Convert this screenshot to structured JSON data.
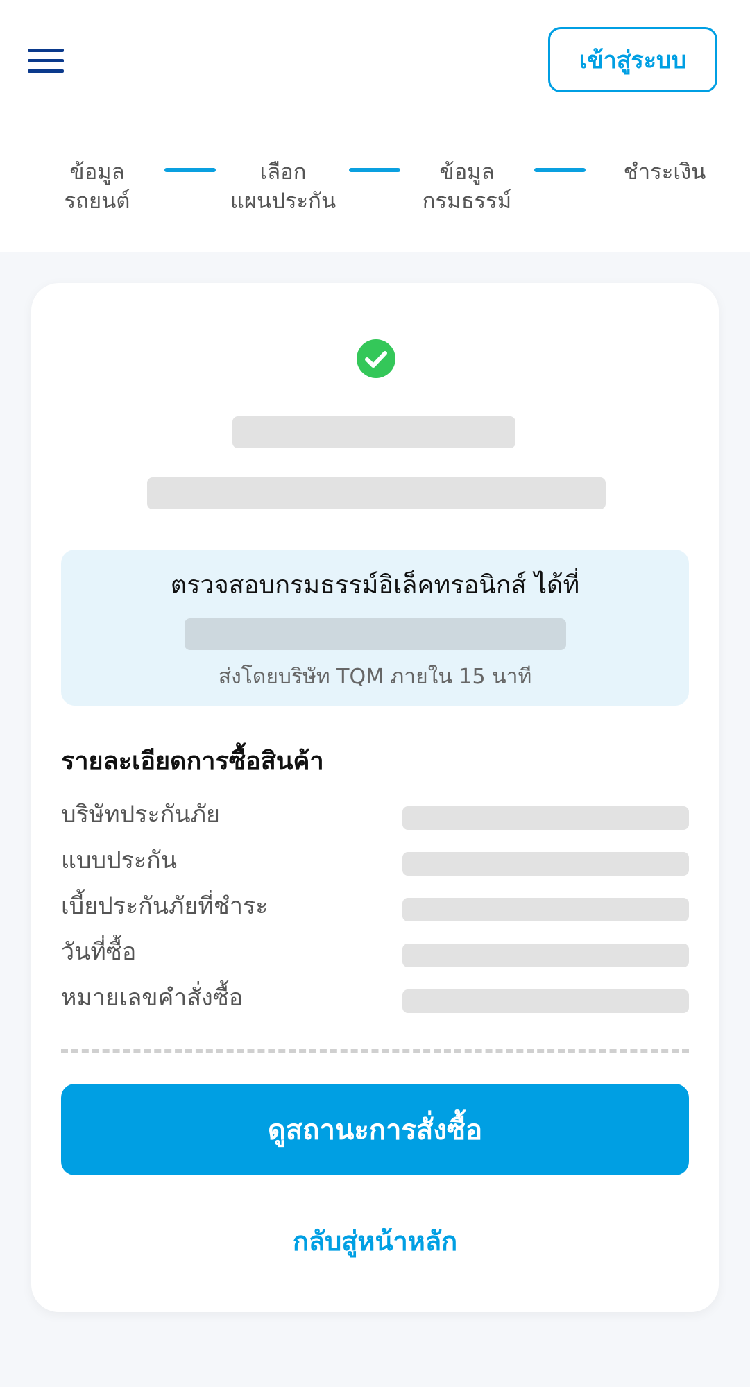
{
  "header": {
    "menu_icon": "hamburger-menu-icon",
    "login_label": "เข้าสู่ระบบ"
  },
  "stepper": {
    "steps": [
      {
        "label": "ข้อมูล\nรถยนต์"
      },
      {
        "label": "เลือก\nแผนประกัน"
      },
      {
        "label": "ข้อมูล\nกรมธรรม์"
      },
      {
        "label": "ชำระเงิน"
      }
    ]
  },
  "card": {
    "status_icon": "check-circle-icon",
    "info_box": {
      "title": "ตรวจสอบกรมธรรม์อิเล็คทรอนิกส์ ได้ที่",
      "note": "ส่งโดยบริษัท TQM ภายใน 15 นาที"
    },
    "details": {
      "title": "รายละเอียดการซื้อสินค้า",
      "rows": [
        {
          "label": "บริษัทประกันภัย"
        },
        {
          "label": "แบบประกัน"
        },
        {
          "label": "เบี้ยประกันภัยที่ชำระ"
        },
        {
          "label": "วันที่ซื้อ"
        },
        {
          "label": "หมายเลขคำสั่งซื้อ"
        }
      ]
    },
    "primary_button": "ดูสถานะการสั่งซื้อ",
    "back_link": "กลับสู่หน้าหลัก"
  },
  "colors": {
    "accent": "#009fe3",
    "navy": "#0b3a8c",
    "success": "#34c759",
    "info_bg": "#e6f4fb",
    "skeleton": "#e2e2e2"
  }
}
